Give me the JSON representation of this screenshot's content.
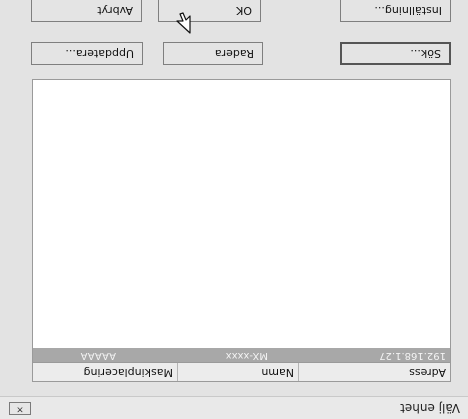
{
  "window": {
    "title": "Välj enhet",
    "close_label": "×"
  },
  "devices": {
    "columns": [
      "Adress",
      "Namn",
      "Maskinplacering"
    ],
    "rows": [
      {
        "adress": "192.168.1.27",
        "namn": "MX-xxxx",
        "maskinplacering": "AAAAA"
      }
    ]
  },
  "buttons": {
    "search": "Sök...",
    "delete": "Radera",
    "update": "Uppdatera...",
    "settings": "Inställning...",
    "ok": "OK",
    "cancel": "Avbryt"
  }
}
